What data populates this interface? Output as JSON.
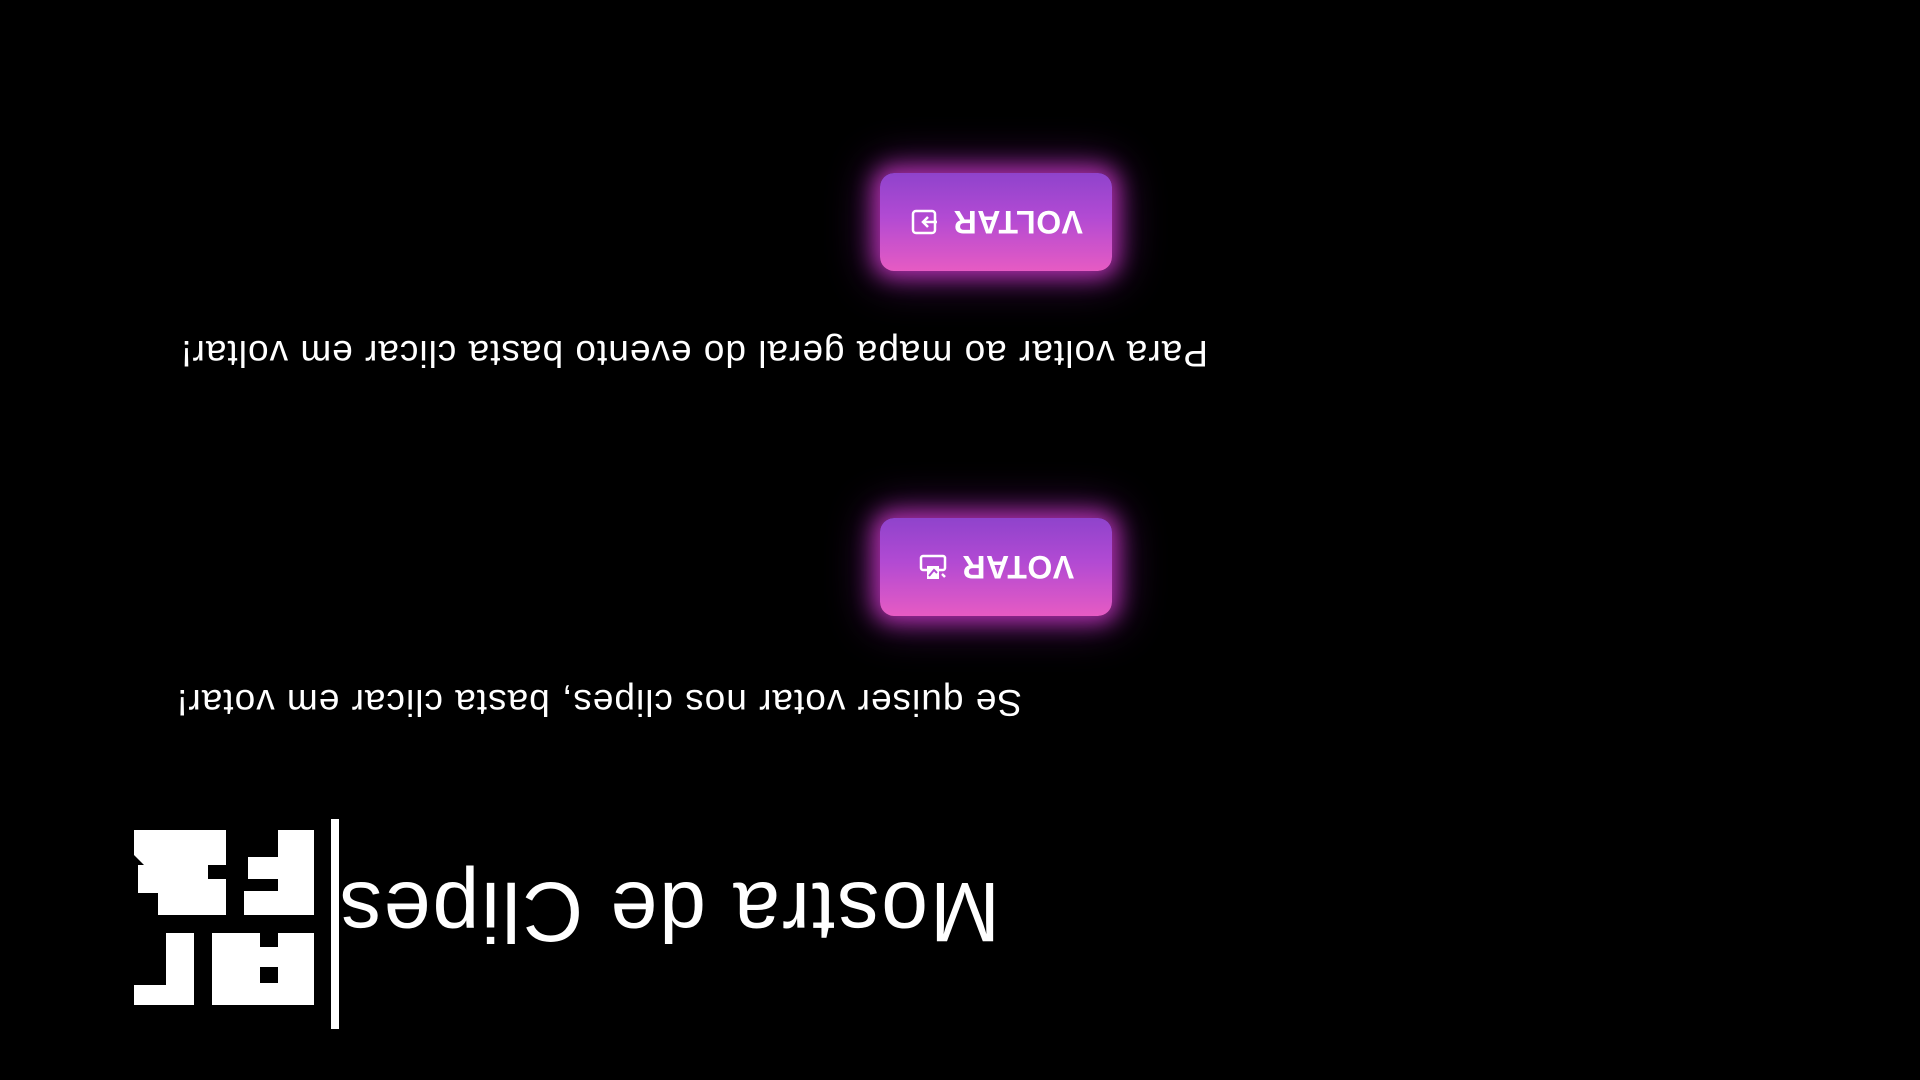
{
  "header": {
    "title": "Mostra de Clipes"
  },
  "sections": [
    {
      "message": "Se quiser votar nos clipes, basta clicar em votar!",
      "button_label": "VOTAR",
      "button_icon": "ballot-icon"
    },
    {
      "message": "Para voltar ao mapa geral do evento basta clicar em voltar!",
      "button_label": "VOLTAR",
      "button_icon": "exit-icon"
    }
  ],
  "colors": {
    "background": "#000000",
    "button_gradient_top": "#e65bc3",
    "button_gradient_bottom": "#8f43cc",
    "glow": "#d63cce",
    "text": "#ffffff"
  }
}
